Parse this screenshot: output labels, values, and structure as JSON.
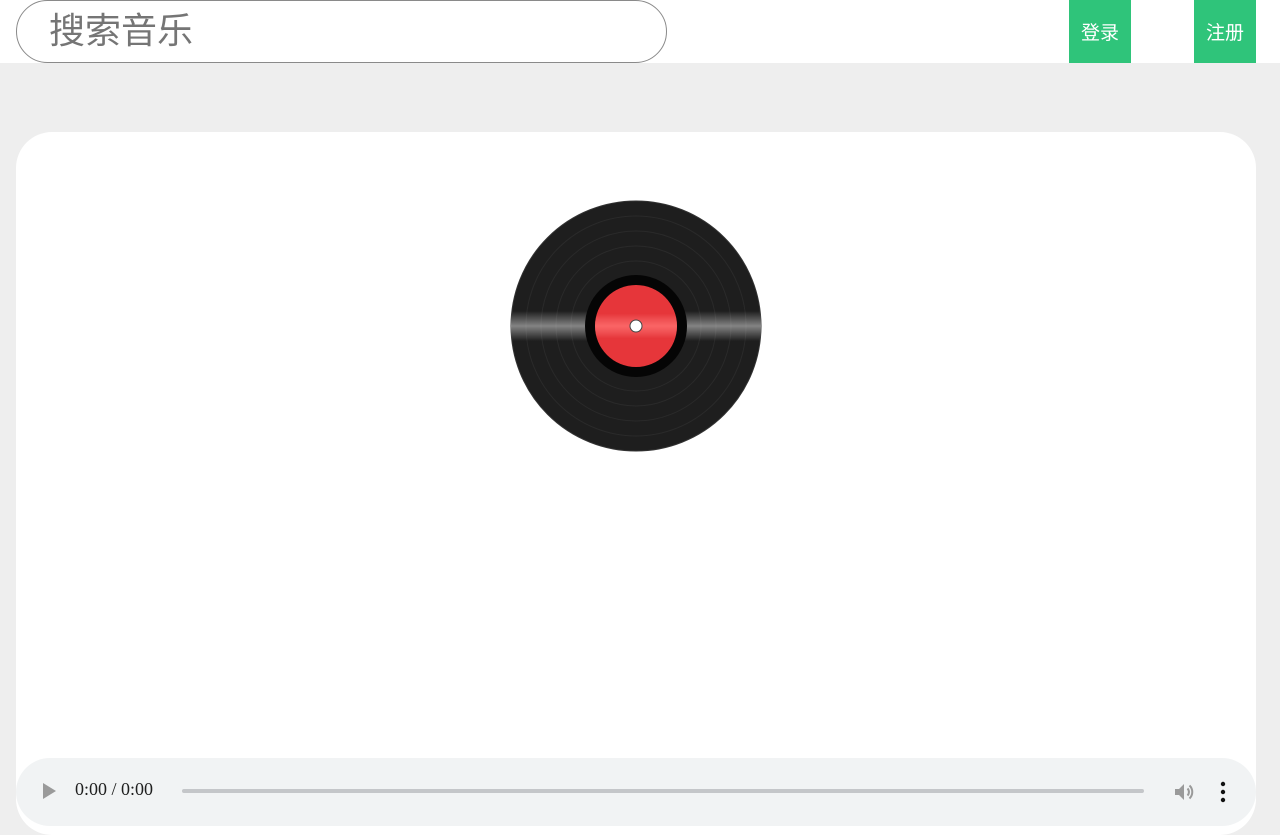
{
  "header": {
    "search_placeholder": "搜索音乐",
    "login_label": "登录",
    "register_label": "注册"
  },
  "player": {
    "time_display": "0:00 / 0:00",
    "progress": 0
  },
  "colors": {
    "accent": "#2fc47a",
    "record_label": "#e6363a",
    "background": "#eeeeee"
  },
  "icons": {
    "play": "play-icon",
    "volume": "volume-icon",
    "menu": "more-vertical-icon",
    "record": "vinyl-record-icon"
  }
}
